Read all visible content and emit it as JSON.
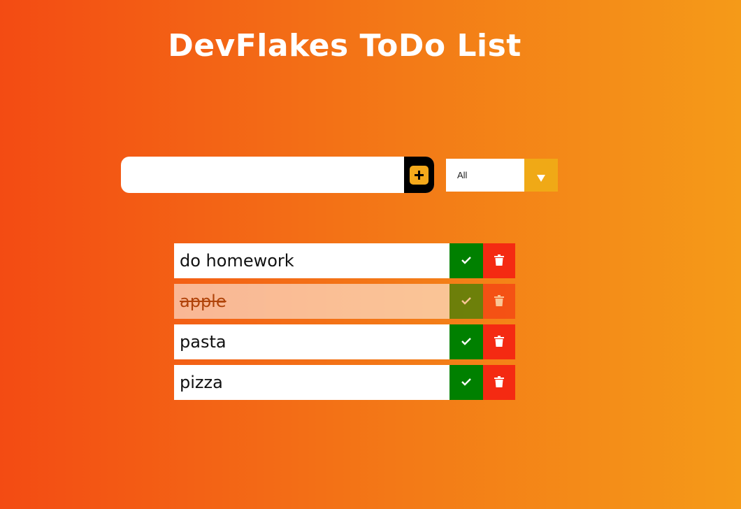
{
  "header": {
    "title": "DevFlakes ToDo List"
  },
  "form": {
    "input_value": "",
    "add_icon": "plus-icon",
    "filter": {
      "selected": "All",
      "arrow_icon": "triangle-down-icon"
    }
  },
  "todos": [
    {
      "text": "do homework",
      "completed": false
    },
    {
      "text": "apple",
      "completed": true
    },
    {
      "text": "pasta",
      "completed": false
    },
    {
      "text": "pizza",
      "completed": false
    }
  ],
  "colors": {
    "check": "#008000",
    "trash": "#f42a12",
    "add_button_bg": "#000000",
    "add_icon": "#f5a91b",
    "filter_arrow_bg": "#f0a916"
  }
}
